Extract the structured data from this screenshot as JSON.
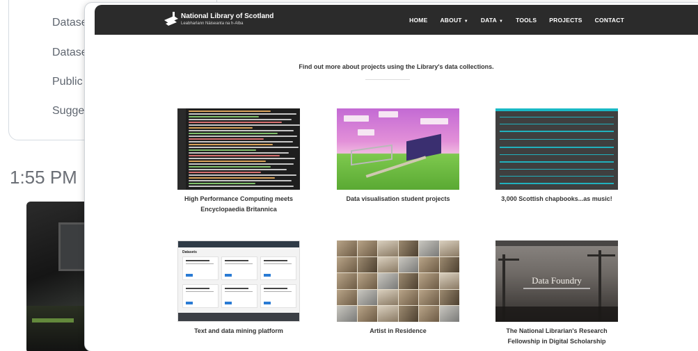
{
  "background": {
    "links": [
      "Datase",
      "Datase",
      "Public",
      "Sugge"
    ],
    "time": "1:55 PM"
  },
  "site": {
    "logo_title": "National Library of Scotland",
    "logo_subtitle": "Leabharlann Nàiseanta na h-Alba",
    "nav": [
      {
        "label": "HOME",
        "dropdown": false
      },
      {
        "label": "ABOUT",
        "dropdown": true
      },
      {
        "label": "DATA",
        "dropdown": true
      },
      {
        "label": "TOOLS",
        "dropdown": false
      },
      {
        "label": "PROJECTS",
        "dropdown": false
      },
      {
        "label": "CONTACT",
        "dropdown": false
      }
    ],
    "intro": "Find out more about projects using the Library's data collections.",
    "projects": [
      {
        "label": "High Performance Computing meets Encyclopaedia Britannica"
      },
      {
        "label": "Data visualisation student projects"
      },
      {
        "label": "3,000 Scottish chapbooks...as music!"
      },
      {
        "label": "Text and data mining platform",
        "thumb_heading": "Datasets"
      },
      {
        "label": "Artist in Residence"
      },
      {
        "label": "The National Librarian's Research Fellowship in Digital Scholarship",
        "thumb_title": "Data Foundry"
      }
    ]
  },
  "colors": {
    "navbar": "#2b2b2b",
    "accent_audio": "#1cc6d4",
    "button_blue": "#2a7bd4"
  }
}
